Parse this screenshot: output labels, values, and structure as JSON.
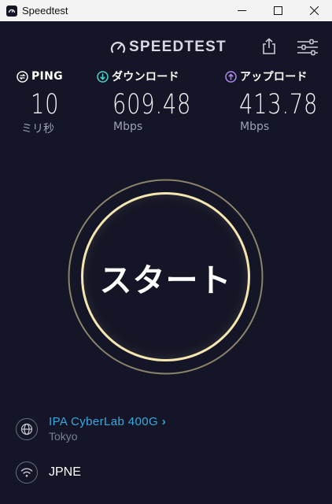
{
  "window": {
    "title": "Speedtest",
    "controls": {
      "minimize": "—",
      "maximize": "☐",
      "close": "✕"
    }
  },
  "header": {
    "brand": "SPEEDTEST",
    "icons": {
      "share": "share-icon",
      "settings": "sliders-icon"
    }
  },
  "metrics": {
    "ping": {
      "label": "PING",
      "value": "10",
      "unit": "ミリ秒",
      "icon": "ping-icon",
      "color": "#ffffff"
    },
    "download": {
      "label": "ダウンロード",
      "value": "609.48",
      "unit": "Mbps",
      "icon": "download-arrow-icon",
      "color": "#4ed4d0"
    },
    "upload": {
      "label": "アップロード",
      "value": "413.78",
      "unit": "Mbps",
      "icon": "upload-arrow-icon",
      "color": "#b387f5"
    }
  },
  "start_button": {
    "label": "スタート",
    "ring_color": "#f3e6b0"
  },
  "server": {
    "name": "IPA CyberLab 400G",
    "chevron": "›",
    "location": "Tokyo",
    "icon": "globe-icon"
  },
  "isp": {
    "name": "JPNE",
    "icon": "wifi-icon"
  },
  "colors": {
    "background": "#141526",
    "accent": "#3aa8e0"
  }
}
